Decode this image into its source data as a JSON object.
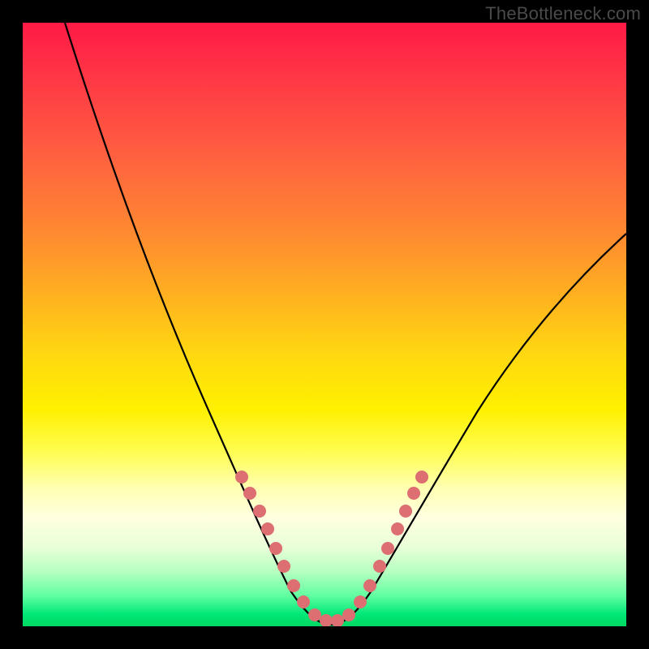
{
  "watermark": {
    "text": "TheBottleneck.com"
  },
  "chart_data": {
    "type": "line",
    "title": "",
    "xlabel": "",
    "ylabel": "",
    "xlim": [
      0,
      100
    ],
    "ylim": [
      0,
      100
    ],
    "grid": false,
    "series": [
      {
        "name": "left-branch",
        "x": [
          7,
          10,
          15,
          20,
          25,
          30,
          33,
          36,
          38,
          40,
          42,
          44,
          46,
          48,
          50
        ],
        "y": [
          100,
          90,
          74,
          60,
          48,
          37,
          31,
          25,
          20,
          16,
          12,
          8,
          5,
          2,
          0
        ]
      },
      {
        "name": "right-branch",
        "x": [
          50,
          52,
          54,
          56,
          58,
          60,
          63,
          66,
          70,
          75,
          80,
          85,
          90,
          95,
          100
        ],
        "y": [
          0,
          2,
          4,
          7,
          10,
          14,
          19,
          24,
          31,
          38,
          45,
          51,
          56,
          61,
          65
        ]
      }
    ],
    "markers": {
      "name": "highlight-dots",
      "color": "#e07070",
      "points": [
        {
          "x": 36,
          "y": 25
        },
        {
          "x": 37.5,
          "y": 22
        },
        {
          "x": 39,
          "y": 18
        },
        {
          "x": 41,
          "y": 14
        },
        {
          "x": 42.5,
          "y": 11
        },
        {
          "x": 44,
          "y": 8
        },
        {
          "x": 46,
          "y": 4
        },
        {
          "x": 47.5,
          "y": 2
        },
        {
          "x": 49,
          "y": 1
        },
        {
          "x": 50,
          "y": 0.5
        },
        {
          "x": 51,
          "y": 0.5
        },
        {
          "x": 52.5,
          "y": 1
        },
        {
          "x": 54,
          "y": 2
        },
        {
          "x": 55.5,
          "y": 4
        },
        {
          "x": 57,
          "y": 7
        },
        {
          "x": 58.5,
          "y": 11
        },
        {
          "x": 60,
          "y": 14
        },
        {
          "x": 61.5,
          "y": 18
        },
        {
          "x": 63,
          "y": 22
        },
        {
          "x": 64.5,
          "y": 25
        }
      ]
    }
  }
}
